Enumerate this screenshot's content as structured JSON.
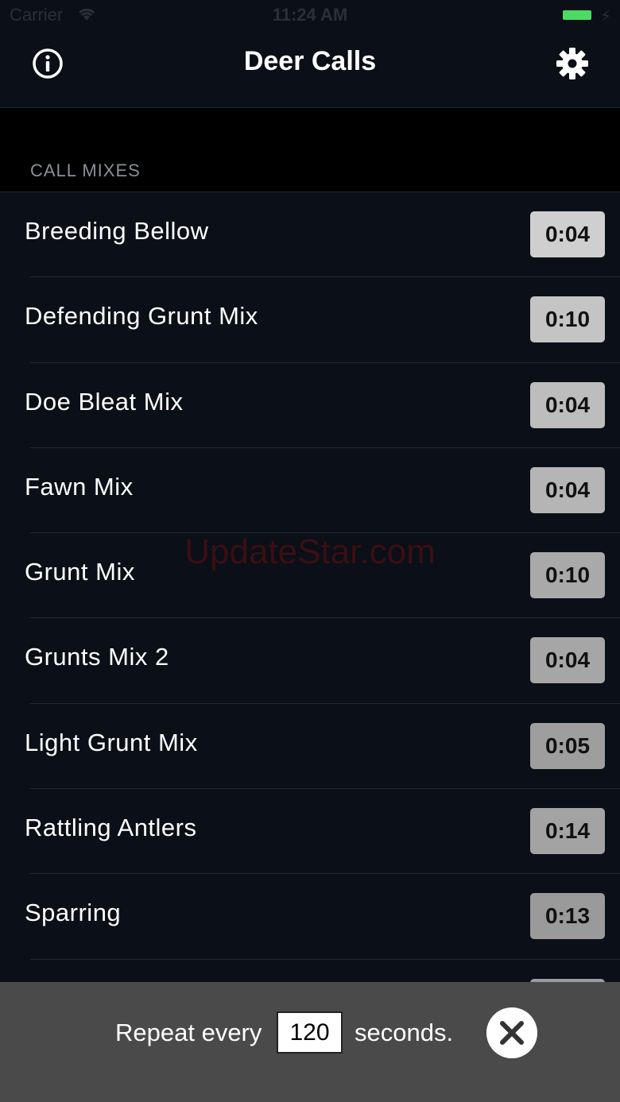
{
  "status_bar": {
    "carrier": "Carrier",
    "time": "11:24 AM",
    "battery_color": "#4cd964"
  },
  "nav": {
    "title": "Deer Calls",
    "left_icon": "info-icon",
    "right_icon": "gear-icon"
  },
  "section": {
    "header": "CALL MIXES"
  },
  "calls": [
    {
      "label": "Breeding Bellow",
      "duration": "0:04"
    },
    {
      "label": "Defending Grunt Mix",
      "duration": "0:10"
    },
    {
      "label": "Doe Bleat Mix",
      "duration": "0:04"
    },
    {
      "label": "Fawn Mix",
      "duration": "0:04"
    },
    {
      "label": "Grunt Mix",
      "duration": "0:10"
    },
    {
      "label": "Grunts Mix 2",
      "duration": "0:04"
    },
    {
      "label": "Light Grunt Mix",
      "duration": "0:05"
    },
    {
      "label": "Rattling Antlers",
      "duration": "0:14"
    },
    {
      "label": "Sparring",
      "duration": "0:13"
    },
    {
      "label": "",
      "duration": ""
    }
  ],
  "watermark": "UpdateStar.com",
  "repeat_bar": {
    "prefix": "Repeat every",
    "value": "120",
    "suffix": "seconds.",
    "close_icon": "close-icon"
  }
}
